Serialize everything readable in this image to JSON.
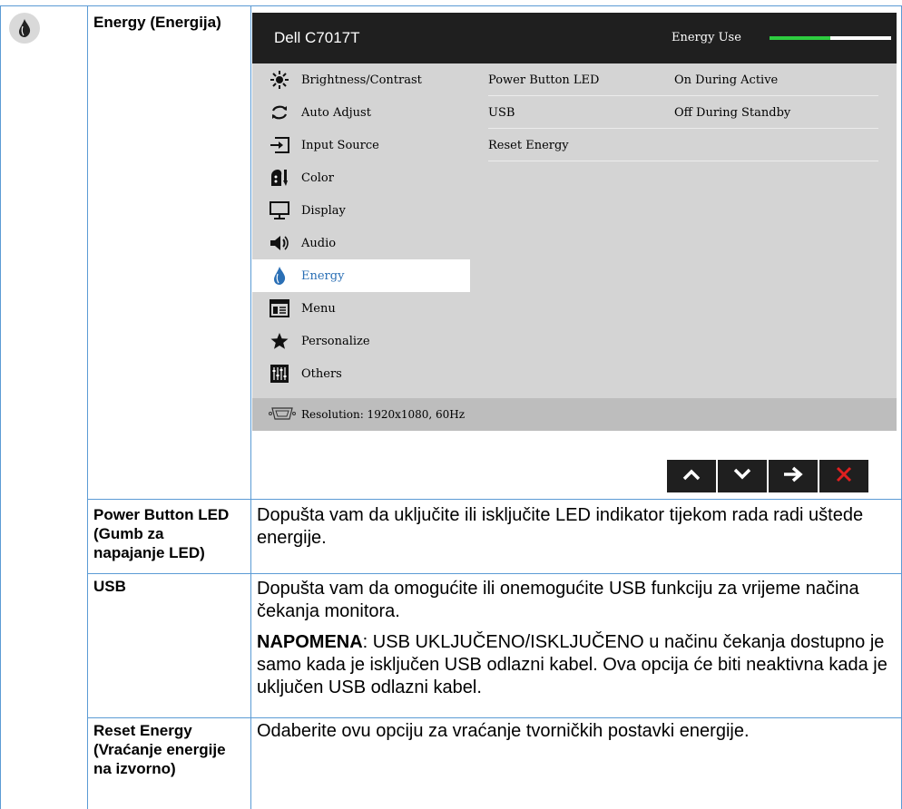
{
  "section": {
    "icon": "energy-drop-icon",
    "label": "Energy (Energija)"
  },
  "osd": {
    "title": "Dell C7017T",
    "energy_use_label": "Energy Use",
    "energy_use_level": 0.5,
    "accent_color": "#2ecc40",
    "menu": [
      {
        "label": "Brightness/Contrast",
        "icon": "sun-icon"
      },
      {
        "label": "Auto Adjust",
        "icon": "auto-adjust-icon"
      },
      {
        "label": "Input Source",
        "icon": "input-source-icon"
      },
      {
        "label": "Color",
        "icon": "color-icon"
      },
      {
        "label": "Display",
        "icon": "monitor-icon"
      },
      {
        "label": "Audio",
        "icon": "speaker-icon"
      },
      {
        "label": "Energy",
        "icon": "energy-drop-icon",
        "active": true
      },
      {
        "label": "Menu",
        "icon": "menu-window-icon"
      },
      {
        "label": "Personalize",
        "icon": "star-icon"
      },
      {
        "label": "Others",
        "icon": "sliders-icon"
      }
    ],
    "settings": [
      {
        "name": "Power Button LED",
        "value": "On During Active"
      },
      {
        "name": "USB",
        "value": "Off During Standby"
      },
      {
        "name": "Reset Energy",
        "value": ""
      }
    ],
    "resolution": "Resolution: 1920x1080, 60Hz",
    "nav_buttons": [
      "up-icon",
      "down-icon",
      "right-arrow-icon",
      "close-icon"
    ]
  },
  "rows": [
    {
      "label": "Power Button LED (Gumb za napajanje LED)",
      "desc": "Dopušta vam da uključite ili isključite LED indikator tijekom rada radi uštede energije."
    },
    {
      "label": "USB",
      "desc": "Dopušta vam da omogućite ili onemogućite USB funkciju za vrijeme načina čekanja monitora.",
      "note_label": "NAPOMENA",
      "note_text": ": USB UKLJUČENO/ISKLJUČENO u načinu čekanja dostupno je samo kada je isključen USB odlazni kabel. Ova opcija će biti neaktivna kada je uključen USB odlazni kabel."
    },
    {
      "label": "Reset Energy (Vraćanje energije na izvorno)",
      "desc": "Odaberite ovu opciju za vraćanje tvorničkih postavki energije."
    }
  ]
}
